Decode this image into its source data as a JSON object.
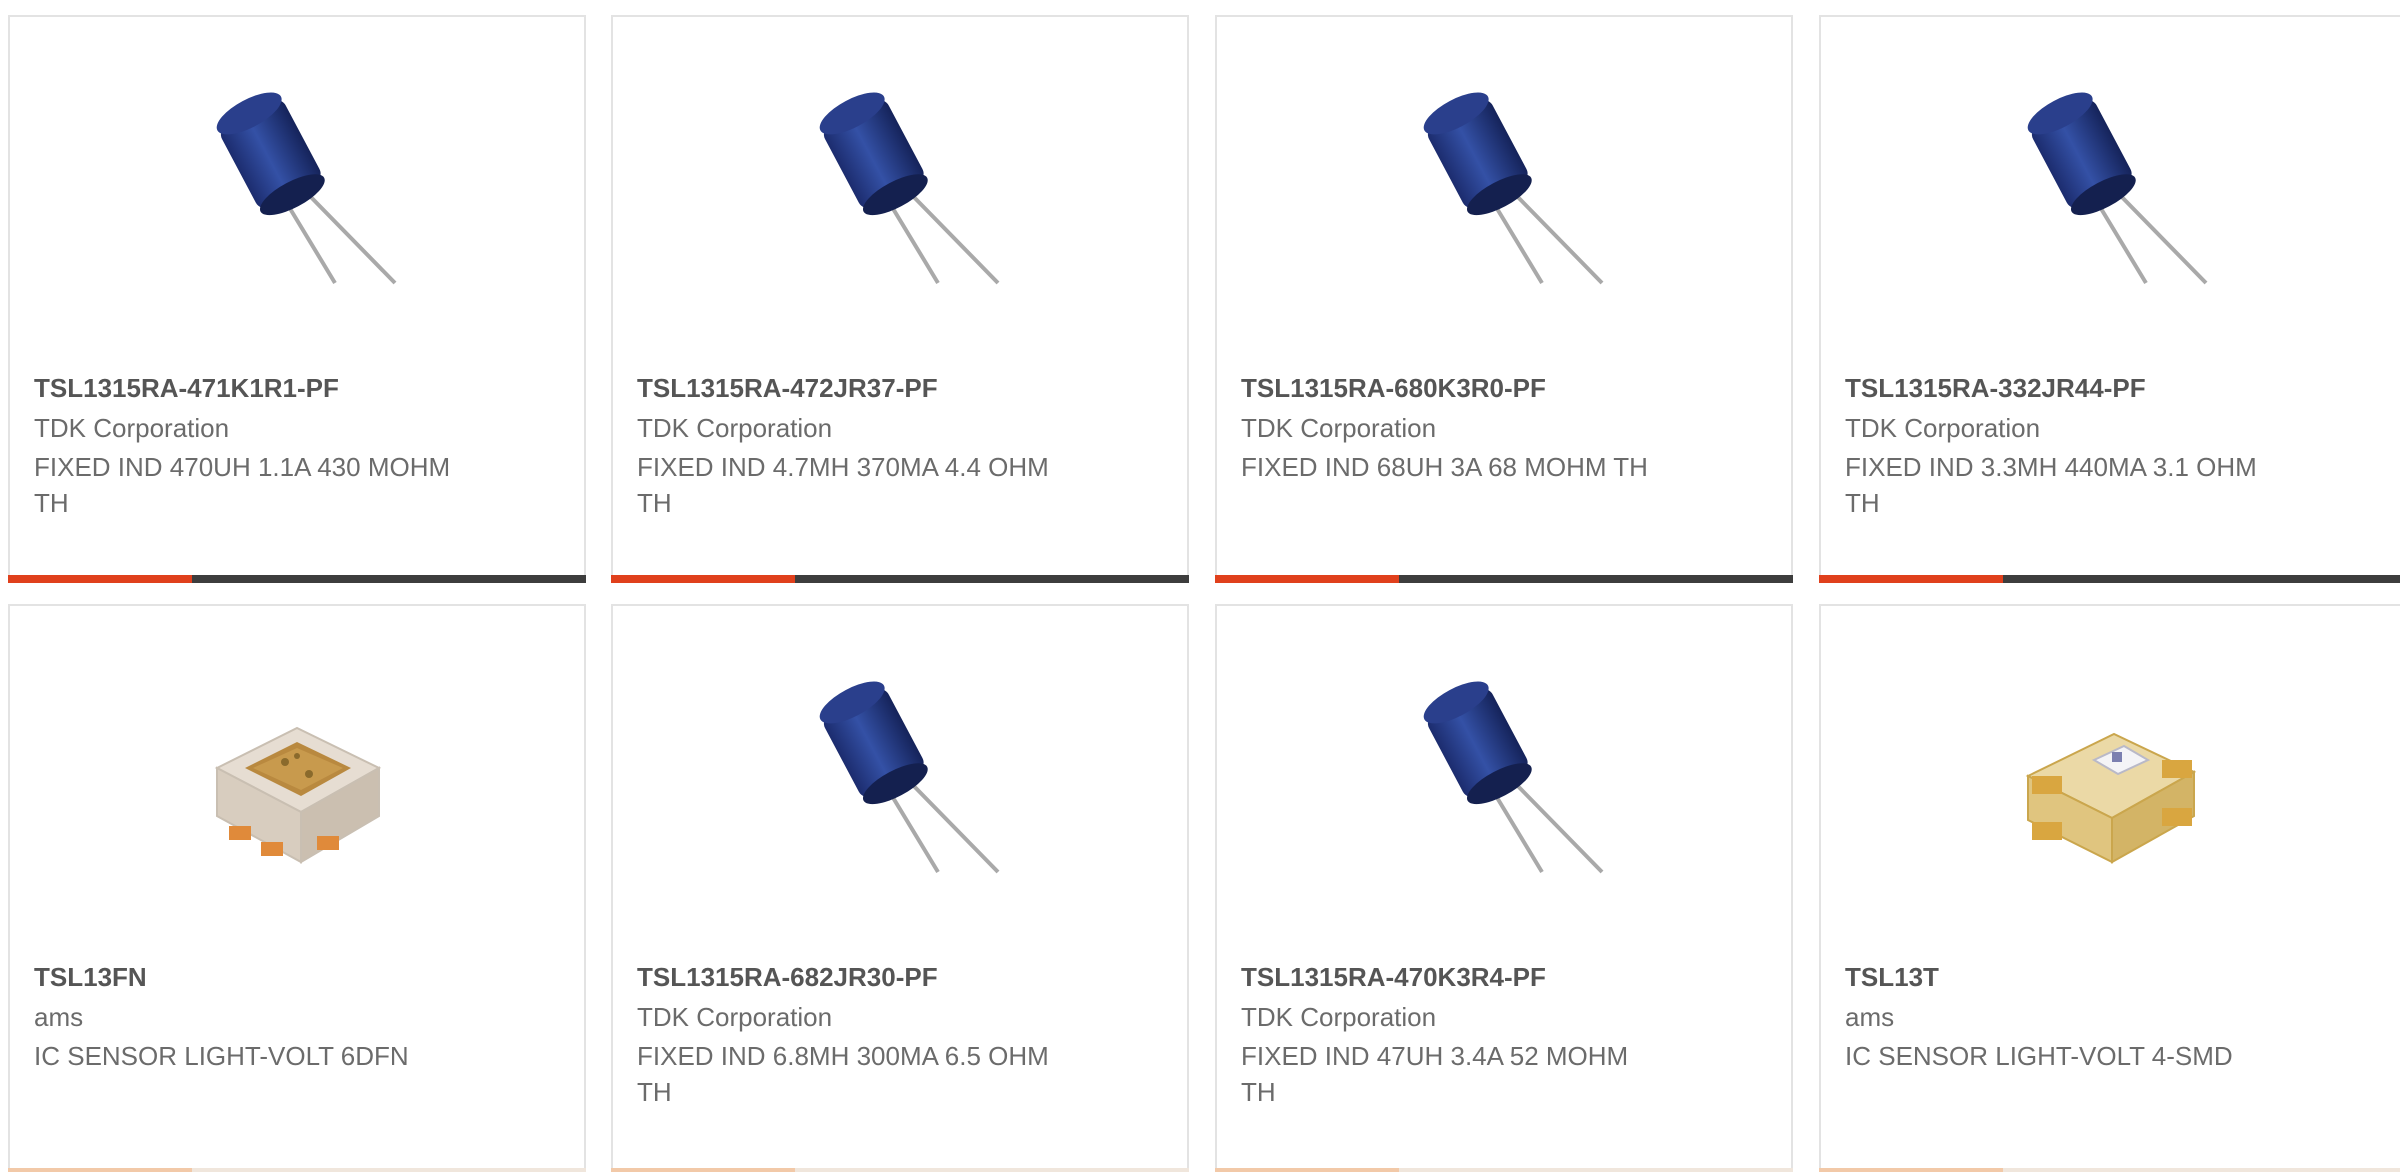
{
  "colors": {
    "accent": "#e0401c",
    "bar_dark": "#3d3d3d",
    "part_text": "#555555",
    "body_text": "#6b6b6b",
    "card_border": "#e3e3e3"
  },
  "products": [
    {
      "part_number": "TSL1315RA-471K1R1-PF",
      "manufacturer": "TDK Corporation",
      "description": "FIXED IND 470UH 1.1A 430 MOHM TH",
      "icon": "inductor-image-icon"
    },
    {
      "part_number": "TSL1315RA-472JR37-PF",
      "manufacturer": "TDK Corporation",
      "description": "FIXED IND 4.7MH 370MA 4.4 OHM TH",
      "icon": "inductor-image-icon"
    },
    {
      "part_number": "TSL1315RA-680K3R0-PF",
      "manufacturer": "TDK Corporation",
      "description": "FIXED IND 68UH 3A 68 MOHM TH",
      "icon": "inductor-image-icon"
    },
    {
      "part_number": "TSL1315RA-332JR44-PF",
      "manufacturer": "TDK Corporation",
      "description": "FIXED IND 3.3MH 440MA 3.1 OHM TH",
      "icon": "inductor-image-icon"
    },
    {
      "part_number": "TSL13FN",
      "manufacturer": "ams",
      "description": "IC SENSOR LIGHT-VOLT 6DFN",
      "icon": "light-sensor-dfn-image-icon"
    },
    {
      "part_number": "TSL1315RA-682JR30-PF",
      "manufacturer": "TDK Corporation",
      "description": "FIXED IND 6.8MH 300MA 6.5 OHM TH",
      "icon": "inductor-image-icon"
    },
    {
      "part_number": "TSL1315RA-470K3R4-PF",
      "manufacturer": "TDK Corporation",
      "description": "FIXED IND 47UH 3.4A 52 MOHM TH",
      "icon": "inductor-image-icon"
    },
    {
      "part_number": "TSL13T",
      "manufacturer": "ams",
      "description": "IC SENSOR LIGHT-VOLT 4-SMD",
      "icon": "light-sensor-smd-image-icon"
    }
  ]
}
